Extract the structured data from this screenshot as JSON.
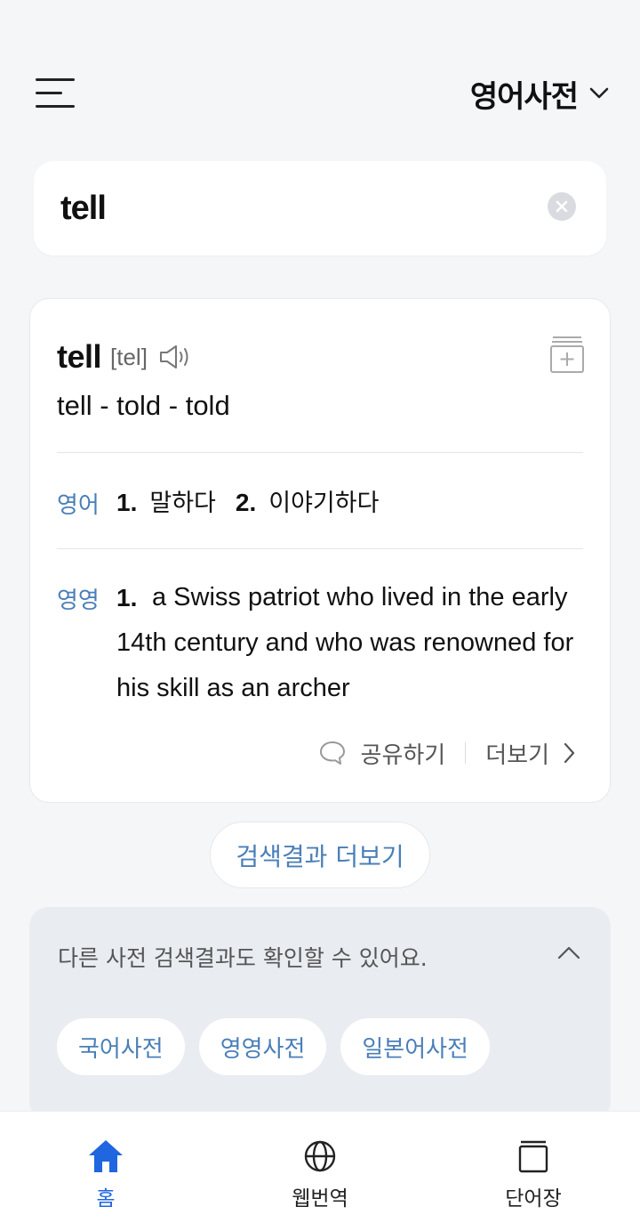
{
  "header": {
    "dictionary": "영어사전"
  },
  "search": {
    "value": "tell"
  },
  "entry": {
    "word": "tell",
    "phonetic": "[tel]",
    "forms": "tell - told - told",
    "korean": {
      "tag": "영어",
      "meanings": [
        {
          "num": "1.",
          "text": "말하다"
        },
        {
          "num": "2.",
          "text": "이야기하다"
        }
      ]
    },
    "english": {
      "tag": "영영",
      "num": "1.",
      "text": "a Swiss patriot who lived in the early 14th century and who was renowned for his skill as an archer"
    },
    "actions": {
      "share": "공유하기",
      "more": "더보기"
    }
  },
  "more_results": "검색결과 더보기",
  "other_dicts": {
    "message": "다른 사전 검색결과도 확인할 수 있어요.",
    "chips": [
      "국어사전",
      "영영사전",
      "일본어사전"
    ]
  },
  "nav": {
    "items": [
      "홈",
      "웹번역",
      "단어장"
    ],
    "active_color": "#1f66e0"
  },
  "colors": {
    "accent_blue": "#4a7fb8",
    "nav_active": "#1f66e0"
  }
}
